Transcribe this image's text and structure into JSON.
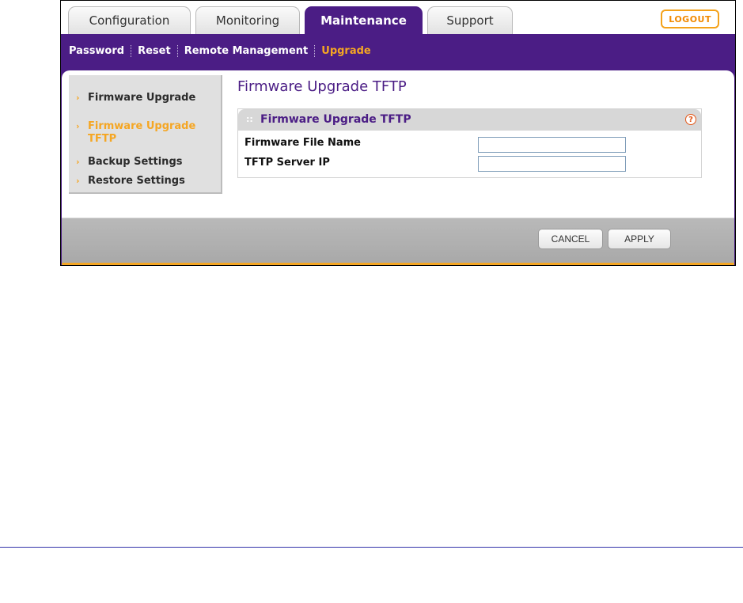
{
  "tabs": [
    {
      "label": "Configuration",
      "active": false
    },
    {
      "label": "Monitoring",
      "active": false
    },
    {
      "label": "Maintenance",
      "active": true
    },
    {
      "label": "Support",
      "active": false
    }
  ],
  "logout_label": "LOGOUT",
  "subnav": [
    {
      "label": "Password",
      "active": false
    },
    {
      "label": "Reset",
      "active": false
    },
    {
      "label": "Remote Management",
      "active": false
    },
    {
      "label": "Upgrade",
      "active": true
    }
  ],
  "sidebar": [
    {
      "label": "Firmware Upgrade",
      "active": false
    },
    {
      "label": "Firmware Upgrade TFTP",
      "active": true
    },
    {
      "label": "Backup Settings",
      "active": false
    },
    {
      "label": "Restore Settings",
      "active": false
    }
  ],
  "page_title": "Firmware Upgrade TFTP",
  "panel": {
    "title": "Firmware Upgrade TFTP",
    "help_icon": "?",
    "fields": [
      {
        "label": "Firmware File Name",
        "value": ""
      },
      {
        "label": "TFTP Server IP",
        "value": ""
      }
    ]
  },
  "buttons": {
    "cancel": "CANCEL",
    "apply": "APPLY"
  },
  "colors": {
    "brand_purple": "#4b1d85",
    "accent_orange": "#f5a623"
  }
}
